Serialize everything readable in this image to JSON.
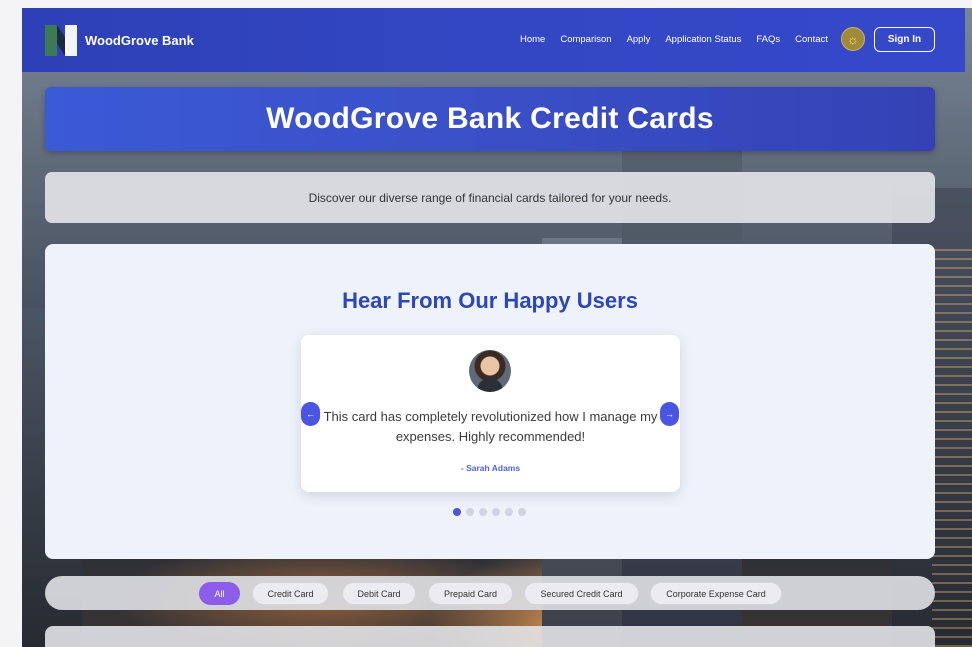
{
  "nav": {
    "brand": "WoodGrove Bank",
    "links": [
      "Home",
      "Comparison",
      "Apply",
      "Application Status",
      "FAQs",
      "Contact"
    ],
    "theme_icon": "sun-icon",
    "signin_label": "Sign In"
  },
  "hero": {
    "title": "WoodGrove Bank Credit Cards"
  },
  "tagline": "Discover our diverse range of financial cards tailored for your needs.",
  "testimonials": {
    "title": "Hear From Our Happy Users",
    "quote": "This card has completely revolutionized how I manage my expenses. Highly recommended!",
    "author": "- Sarah Adams",
    "prev_icon": "←",
    "next_icon": "→",
    "dot_count": 6,
    "active_dot": 0
  },
  "filters": {
    "chips": [
      "All",
      "Credit Card",
      "Debit Card",
      "Prepaid Card",
      "Secured Credit Card",
      "Corporate Expense Card"
    ],
    "active": "All"
  },
  "colors": {
    "nav_bg": "#3347c4",
    "accent": "#2e46b6",
    "active_chip": "#8c5de8",
    "arrow": "#4a56e2"
  }
}
